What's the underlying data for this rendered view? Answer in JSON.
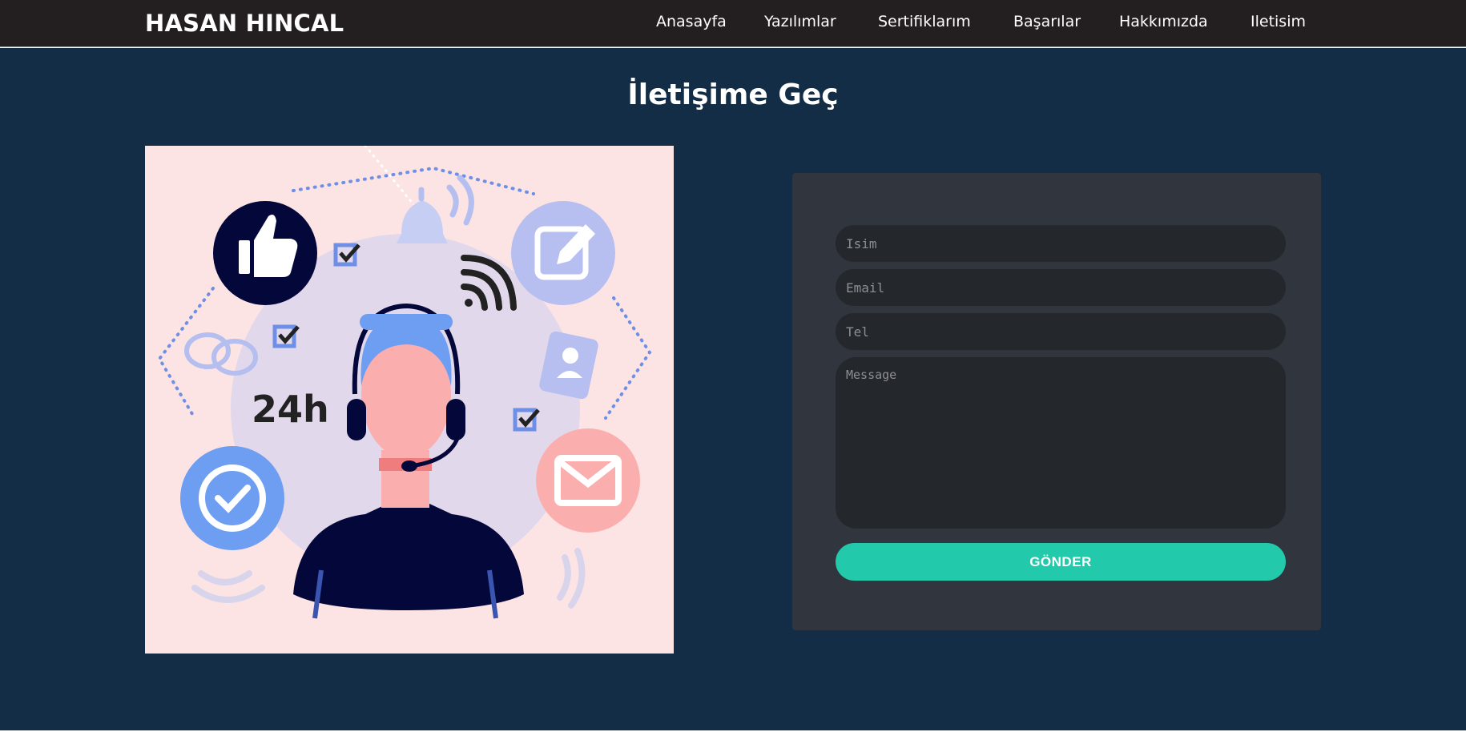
{
  "navbar": {
    "brand": "HASAN HINCAL",
    "links": [
      "Anasayfa",
      "Yazılımlar",
      "Sertifiklarım",
      "Başarılar",
      "Hakkımızda",
      "Iletisim"
    ]
  },
  "contact": {
    "title": "İletişime Geç",
    "illustration": {
      "label_24h": "24h",
      "icons": [
        "thumbs-up-icon",
        "bell-icon",
        "edit-icon",
        "wifi-icon",
        "chat-icon",
        "contact-book-icon",
        "checkmark-circle-icon",
        "mail-icon",
        "headset-icon"
      ]
    },
    "form": {
      "name_placeholder": "Isim",
      "email_placeholder": "Email",
      "phone_placeholder": "Tel",
      "message_placeholder": "Message",
      "name_value": "",
      "email_value": "",
      "phone_value": "",
      "submit_label": "GÖNDER"
    }
  },
  "colors": {
    "navbar_bg": "#231f20",
    "section_bg": "#132d46",
    "card_bg": "#30353e",
    "input_bg": "#24272c",
    "accent": "#22c9ab",
    "illustration_bg": "#fde4e4"
  }
}
